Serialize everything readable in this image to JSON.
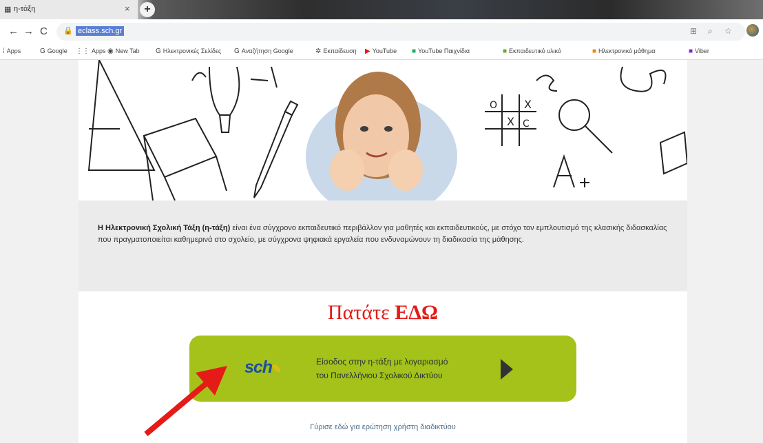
{
  "browser": {
    "tab_title": "η-τάξη",
    "tab_close": "×",
    "new_tab": "+",
    "url": "eclass.sch.gr",
    "nav_back": "←",
    "nav_forward": "→",
    "nav_reload": "C"
  },
  "bookmarks": [
    {
      "icon": "⁞",
      "label": "Apps"
    },
    {
      "icon": "G",
      "label": "Google"
    },
    {
      "icon": "⋮⋮",
      "label": "Apps"
    },
    {
      "icon": "◉",
      "label": "New Tab"
    },
    {
      "icon": "G",
      "label": "Ηλεκτρονικές Σελίδες"
    },
    {
      "icon": "G",
      "label": "Αναζήτηση Google"
    },
    {
      "icon": "✲",
      "label": "Εκπαίδευση"
    },
    {
      "icon": "▶",
      "label": "YouTube"
    },
    {
      "icon": "■",
      "label": "YouTube Παιχνίδια"
    },
    {
      "icon": "■",
      "label": "Εκπαιδευτικό υλικό"
    },
    {
      "icon": "■",
      "label": "Ηλεκτρονικό μάθημα"
    },
    {
      "icon": "■",
      "label": "Viber"
    }
  ],
  "intro": {
    "bold_lead": "Η Ηλεκτρονική Σχολική Τάξη (η-τάξη)",
    "text": " είναι ένα σύγχρονο εκπαιδευτικό περιβάλλον για μαθητές και εκπαιδευτικούς, με στόχο τον εμπλουτισμό της κλασικής διδασκαλίας που πραγματοποιείται καθημερινά στο σχολείο, με σύγχρονα ψηφιακά εργαλεία που ενδυναμώνουν τη διαδικασία της μάθησης."
  },
  "cta": {
    "prefix": "Πατάτε ",
    "bold": "ΕΔΩ"
  },
  "login_button": {
    "logo_text": "sch",
    "line1": "Είσοδος στην η-τάξη με λογαριασμό",
    "line2": "του Πανελλήνιου Σχολικού Δικτύου"
  },
  "footer_link": "Γύρισε εδώ για ερώτηση χρήστη διαδικτύου",
  "colors": {
    "button_green": "#a4c21a",
    "cta_red": "#e41b17",
    "arrow_red": "#e41b17"
  }
}
